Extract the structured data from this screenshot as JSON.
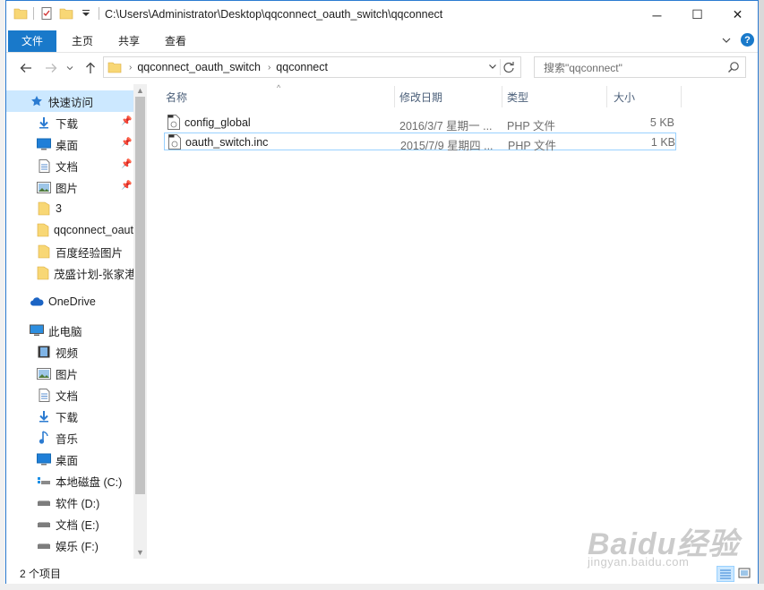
{
  "window": {
    "title": "C:\\Users\\Administrator\\Desktop\\qqconnect_oauth_switch\\qqconnect",
    "controls": {
      "minimize": "─",
      "maximize": "☐",
      "close": "✕"
    }
  },
  "ribbon": {
    "tabs": [
      {
        "label": "文件",
        "active": true
      },
      {
        "label": "主页"
      },
      {
        "label": "共享"
      },
      {
        "label": "查看"
      }
    ],
    "expand_icon": "chevron-down-icon",
    "help": "?"
  },
  "address": {
    "segments": [
      "qqconnect_oauth_switch",
      "qqconnect"
    ],
    "separator": "›"
  },
  "search": {
    "placeholder": "搜索\"qqconnect\""
  },
  "nav": {
    "quick_access": "快速访问",
    "items": [
      {
        "label": "快速访问",
        "icon": "star-icon",
        "pinned": false
      },
      {
        "label": "下载",
        "icon": "download-icon",
        "pinned": true
      },
      {
        "label": "桌面",
        "icon": "desktop-icon",
        "pinned": true
      },
      {
        "label": "文档",
        "icon": "document-icon",
        "pinned": true
      },
      {
        "label": "图片",
        "icon": "picture-icon",
        "pinned": true
      },
      {
        "label": "3",
        "icon": "folder-icon",
        "pinned": false
      },
      {
        "label": "qqconnect_oauth_switch",
        "icon": "folder-icon",
        "pinned": false
      },
      {
        "label": "百度经验图片",
        "icon": "folder-icon",
        "pinned": false
      },
      {
        "label": "茂盛计划-张家港",
        "icon": "folder-icon",
        "pinned": false
      },
      {
        "label": "OneDrive",
        "icon": "cloud-icon",
        "pinned": false
      },
      {
        "label": "此电脑",
        "icon": "computer-icon",
        "pinned": false
      },
      {
        "label": "视频",
        "icon": "video-icon",
        "pinned": false
      },
      {
        "label": "图片",
        "icon": "picture-icon",
        "pinned": false
      },
      {
        "label": "文档",
        "icon": "document-icon",
        "pinned": false
      },
      {
        "label": "下载",
        "icon": "download-icon",
        "pinned": false
      },
      {
        "label": "音乐",
        "icon": "music-icon",
        "pinned": false
      },
      {
        "label": "桌面",
        "icon": "desktop-icon",
        "pinned": false
      },
      {
        "label": "本地磁盘 (C:)",
        "icon": "drive-c-icon",
        "pinned": false
      },
      {
        "label": "软件 (D:)",
        "icon": "drive-icon",
        "pinned": false
      },
      {
        "label": "文档 (E:)",
        "icon": "drive-icon",
        "pinned": false
      },
      {
        "label": "娱乐 (F:)",
        "icon": "drive-icon",
        "pinned": false
      }
    ]
  },
  "columns": {
    "name": "名称",
    "date": "修改日期",
    "type": "类型",
    "size": "大小"
  },
  "files": [
    {
      "name": "config_global",
      "date": "2016/3/7 星期一 ...",
      "type": "PHP 文件",
      "size": "5 KB",
      "icon": "php-file-icon"
    },
    {
      "name": "oauth_switch.inc",
      "date": "2015/7/9 星期四 ...",
      "type": "PHP 文件",
      "size": "1 KB",
      "icon": "php-file-icon"
    }
  ],
  "status": {
    "count": "2 个项目"
  },
  "watermark": {
    "line1": "Baidu经验",
    "line2": "jingyan.baidu.com"
  },
  "colors": {
    "accent": "#1979ca",
    "selection": "#cce8ff",
    "selection_border": "#99d1ff",
    "folder": "#f8d775"
  }
}
